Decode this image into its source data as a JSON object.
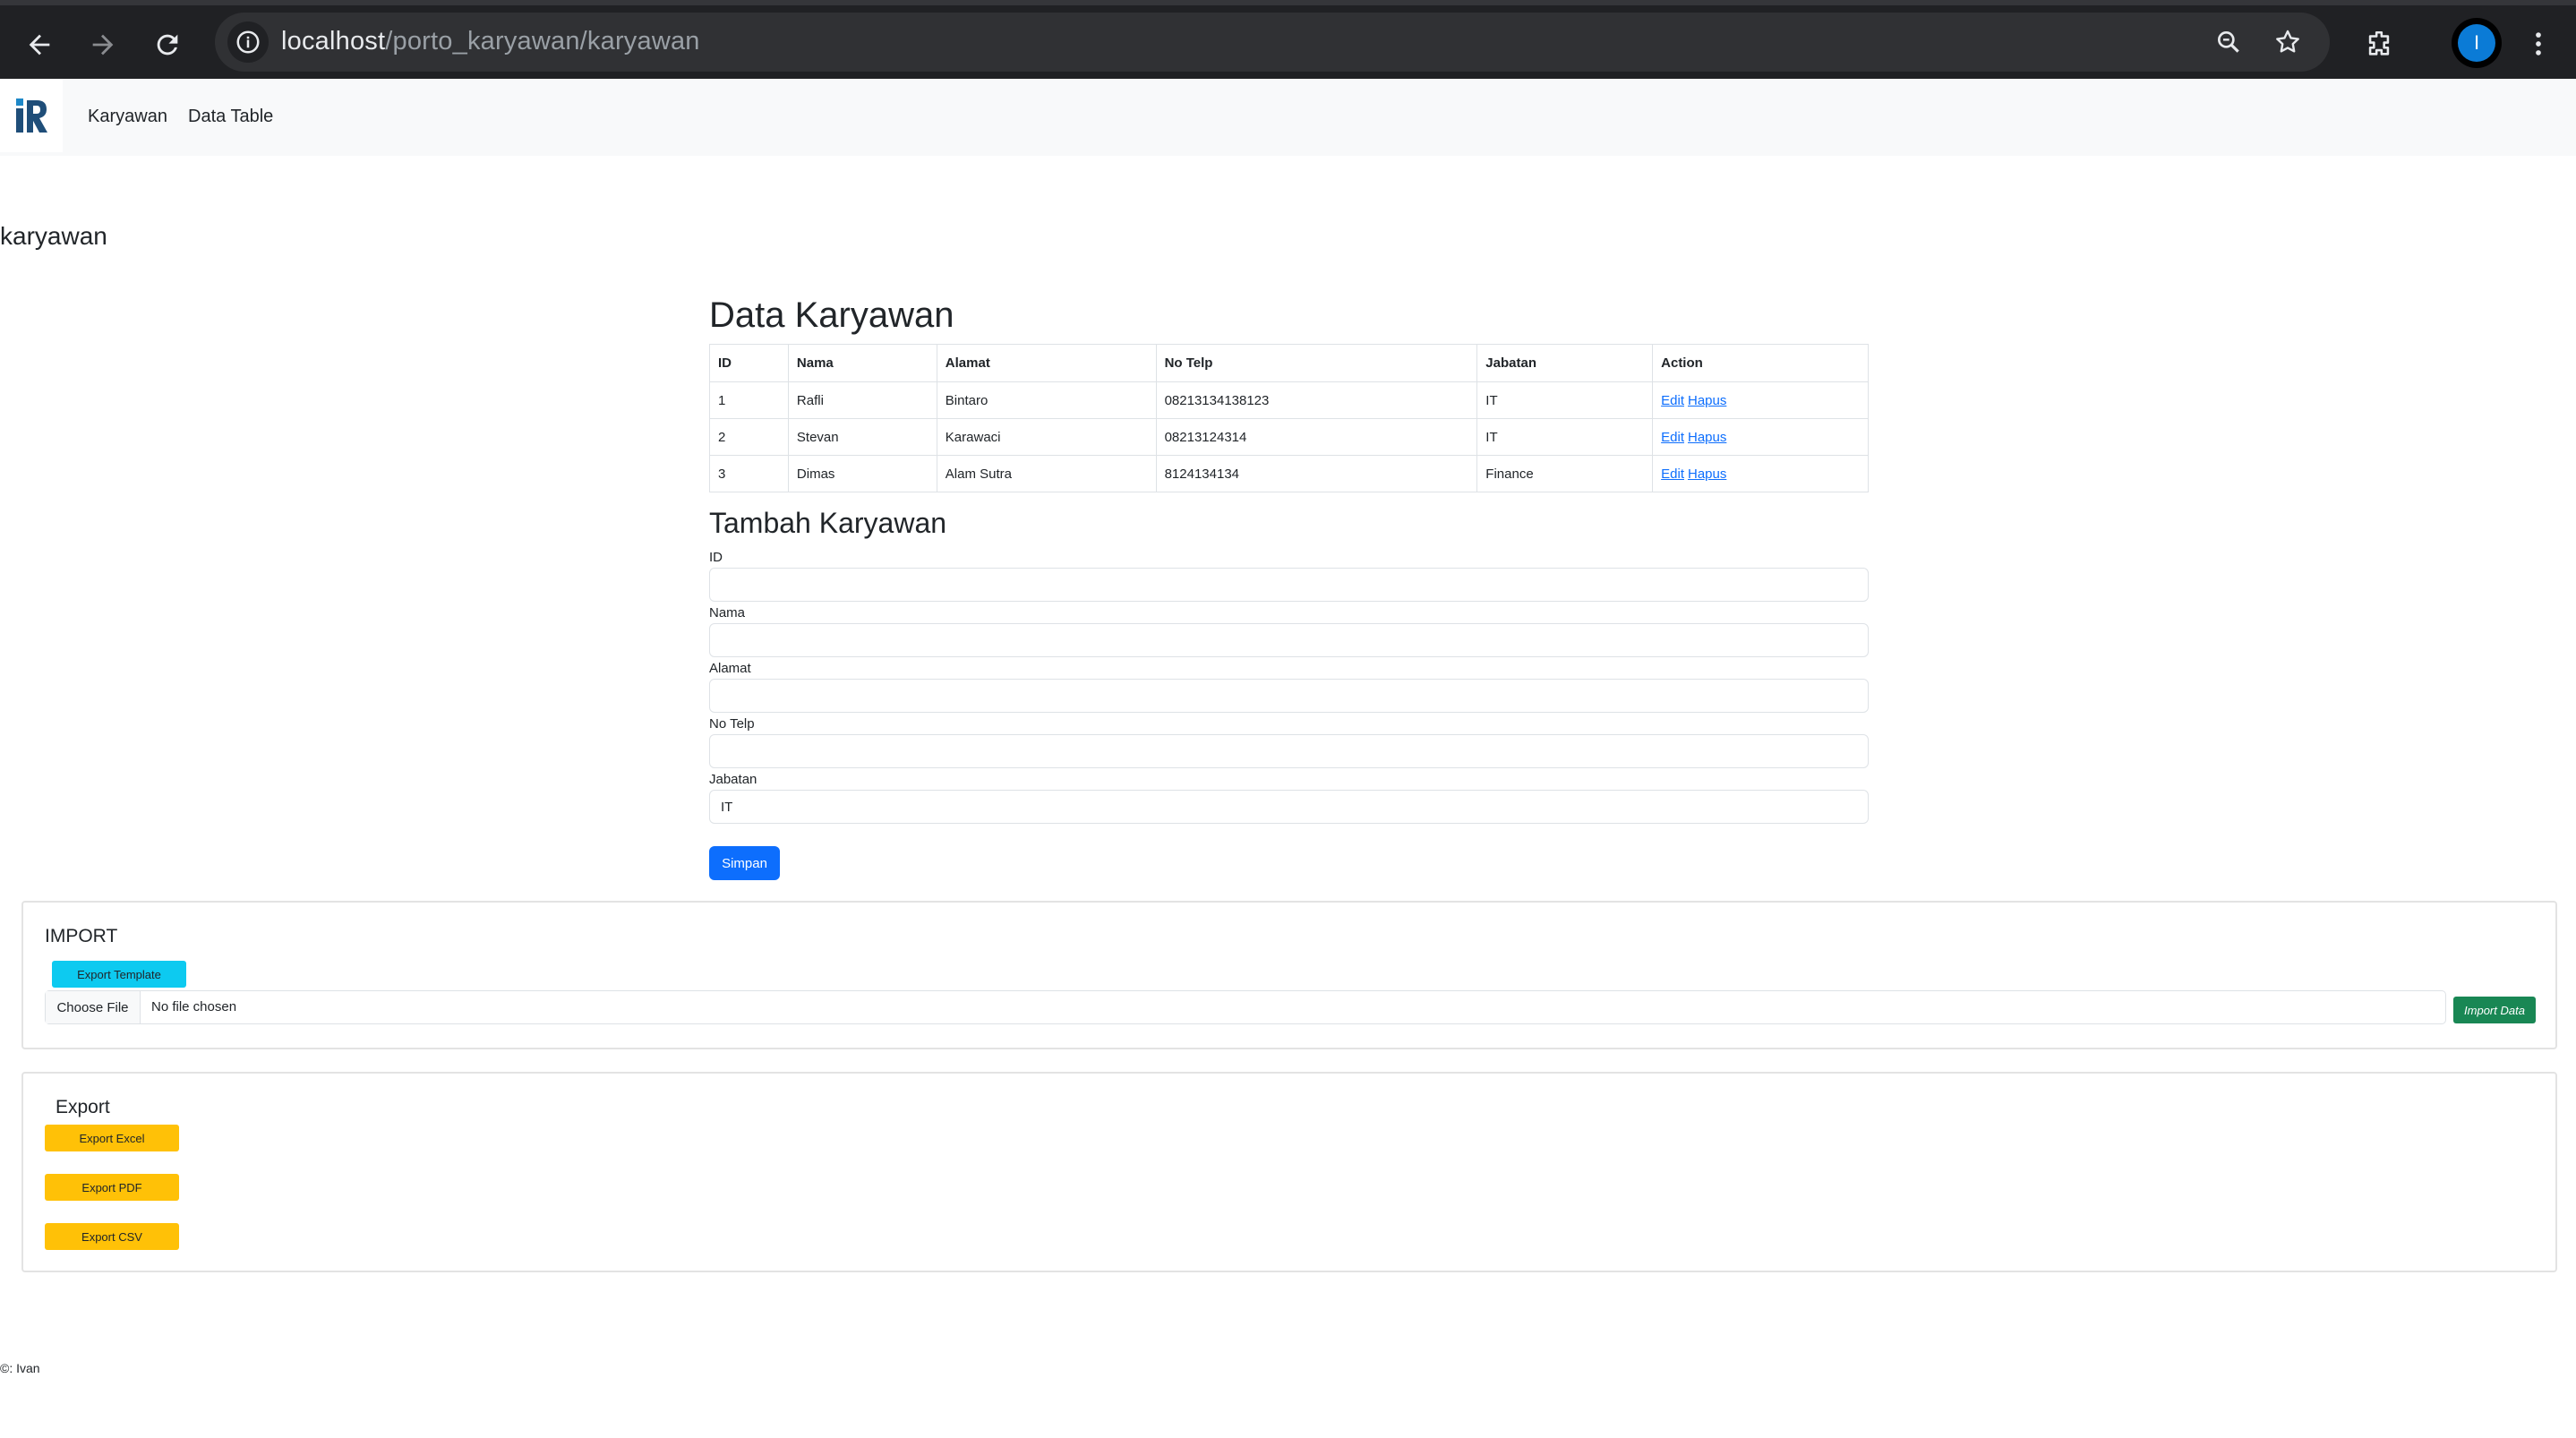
{
  "browser": {
    "url_host": "localhost",
    "url_path": "/porto_karyawan/karyawan",
    "profile_initial": "I"
  },
  "navbar": {
    "brand": "iR",
    "links": [
      "Karyawan",
      "Data Table"
    ]
  },
  "page": {
    "heading": "karyawan"
  },
  "table_section": {
    "title": "Data Karyawan",
    "columns": [
      "ID",
      "Nama",
      "Alamat",
      "No Telp",
      "Jabatan",
      "Action"
    ],
    "rows": [
      {
        "id": "1",
        "nama": "Rafli",
        "alamat": "Bintaro",
        "no_telp": "08213134138123",
        "jabatan": "IT"
      },
      {
        "id": "2",
        "nama": "Stevan",
        "alamat": "Karawaci",
        "no_telp": "08213124314",
        "jabatan": "IT"
      },
      {
        "id": "3",
        "nama": "Dimas",
        "alamat": "Alam Sutra",
        "no_telp": "8124134134",
        "jabatan": "Finance"
      }
    ],
    "action_edit": "Edit",
    "action_delete": "Hapus"
  },
  "form": {
    "title": "Tambah Karyawan",
    "fields": [
      {
        "label": "ID",
        "value": ""
      },
      {
        "label": "Nama",
        "value": ""
      },
      {
        "label": "Alamat",
        "value": ""
      },
      {
        "label": "No Telp",
        "value": ""
      },
      {
        "label": "Jabatan",
        "value": "IT"
      }
    ],
    "submit_label": "Simpan"
  },
  "import_card": {
    "title": "IMPORT",
    "template_button": "Export Template",
    "choose_file": "Choose File",
    "file_status": "No file chosen",
    "import_button": "Import Data"
  },
  "export_card": {
    "title": "Export",
    "buttons": [
      "Export Excel",
      "Export PDF",
      "Export CSV"
    ]
  },
  "footer": {
    "text": "©: Ivan"
  },
  "colors": {
    "primary": "#0d6efd",
    "info": "#0dcaf0",
    "warning": "#ffc107",
    "success": "#198754"
  }
}
